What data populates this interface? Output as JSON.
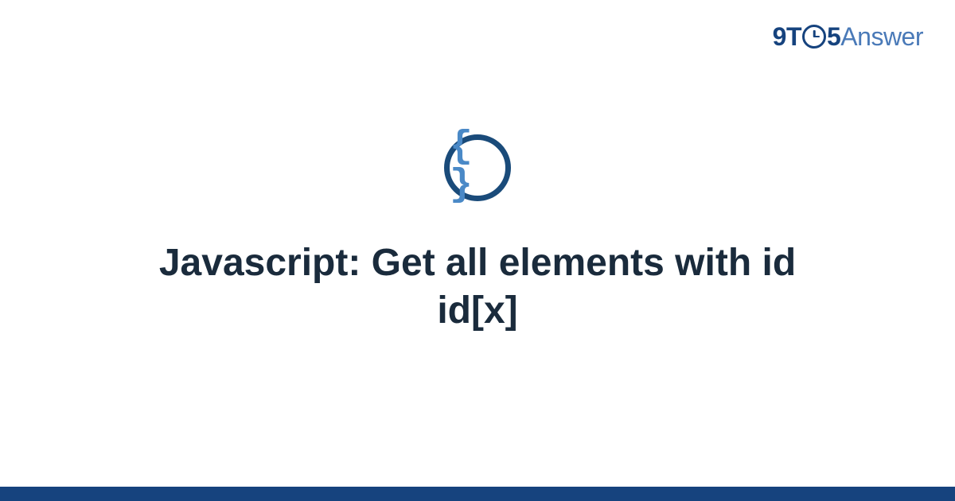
{
  "logo": {
    "nine": "9",
    "t": "T",
    "five": "5",
    "answer": "Answer"
  },
  "icon": {
    "name": "code-braces-icon",
    "glyph": "{ }"
  },
  "title": "Javascript: Get all elements with id id[x]",
  "colors": {
    "brand_dark": "#16437e",
    "brand_light": "#4a7ab8",
    "icon_border": "#1a4b7a",
    "icon_braces": "#4a89c7",
    "text": "#1a2b3c"
  }
}
